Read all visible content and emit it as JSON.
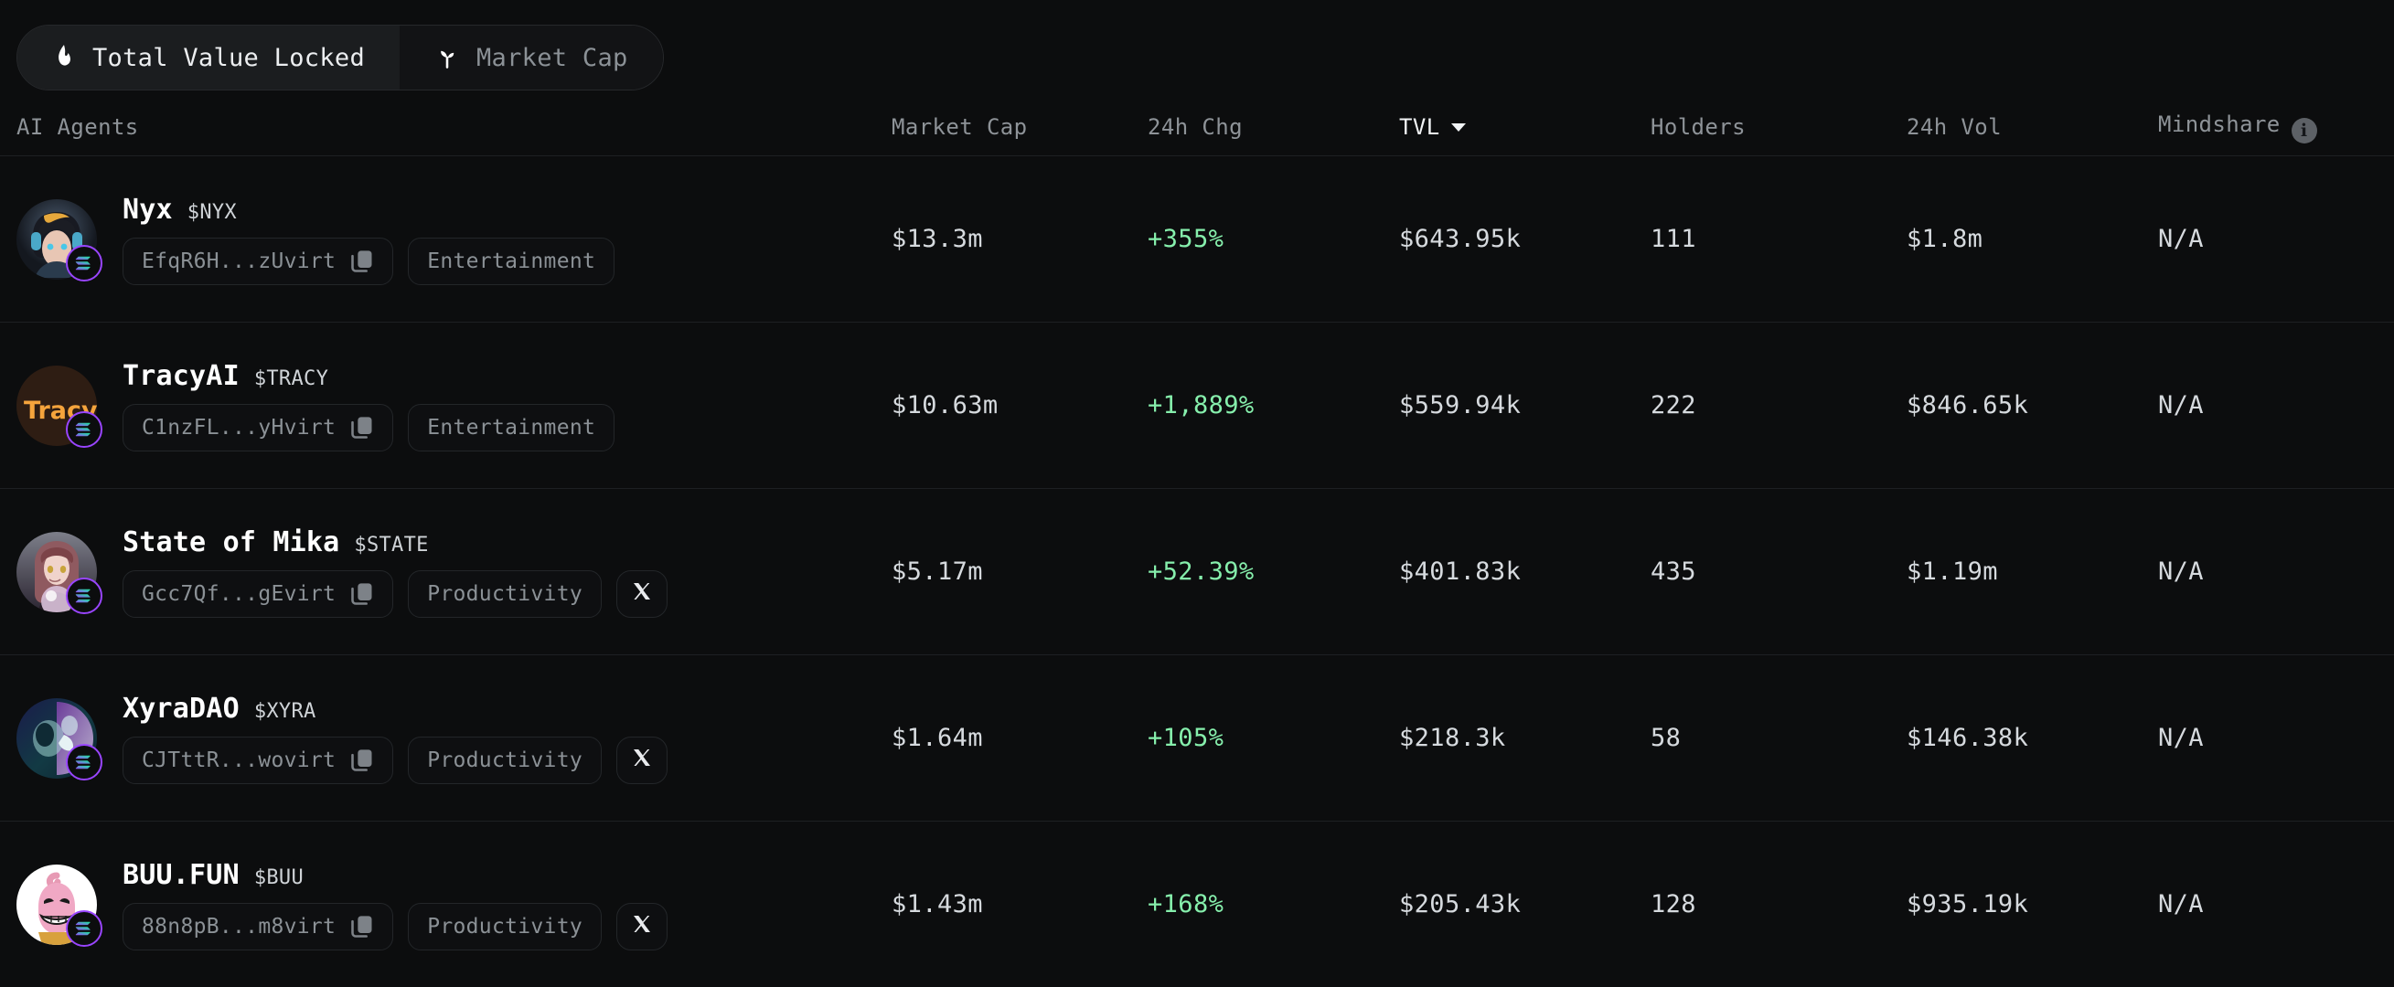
{
  "toggle": {
    "options": [
      {
        "label": "Total Value Locked",
        "icon": "flame-icon",
        "active": true
      },
      {
        "label": "Market Cap",
        "icon": "sprout-icon",
        "active": false
      }
    ]
  },
  "table": {
    "columns": {
      "name": "AI Agents",
      "market_cap": "Market Cap",
      "chg_24h": "24h Chg",
      "tvl": "TVL",
      "holders": "Holders",
      "vol_24h": "24h Vol",
      "mindshare": "Mindshare"
    },
    "sorted_by": "TVL",
    "sort_direction": "desc",
    "mindshare_info_icon": "info-icon",
    "rows": [
      {
        "name": "Nyx",
        "ticker": "$NYX",
        "address": "EfqR6H...zUvirt",
        "category": "Entertainment",
        "has_x_link": false,
        "chain": "solana",
        "market_cap": "$13.3m",
        "chg_24h": "+355%",
        "tvl": "$643.95k",
        "holders": "111",
        "vol_24h": "$1.8m",
        "mindshare": "N/A"
      },
      {
        "name": "TracyAI",
        "ticker": "$TRACY",
        "address": "C1nzFL...yHvirt",
        "category": "Entertainment",
        "has_x_link": false,
        "chain": "solana",
        "market_cap": "$10.63m",
        "chg_24h": "+1,889%",
        "tvl": "$559.94k",
        "holders": "222",
        "vol_24h": "$846.65k",
        "mindshare": "N/A"
      },
      {
        "name": "State of Mika",
        "ticker": "$STATE",
        "address": "Gcc7Qf...gEvirt",
        "category": "Productivity",
        "has_x_link": true,
        "chain": "solana",
        "market_cap": "$5.17m",
        "chg_24h": "+52.39%",
        "tvl": "$401.83k",
        "holders": "435",
        "vol_24h": "$1.19m",
        "mindshare": "N/A"
      },
      {
        "name": "XyraDAO",
        "ticker": "$XYRA",
        "address": "CJTttR...wovirt",
        "category": "Productivity",
        "has_x_link": true,
        "chain": "solana",
        "market_cap": "$1.64m",
        "chg_24h": "+105%",
        "tvl": "$218.3k",
        "holders": "58",
        "vol_24h": "$146.38k",
        "mindshare": "N/A"
      },
      {
        "name": "BUU.FUN",
        "ticker": "$BUU",
        "address": "88n8pB...m8virt",
        "category": "Productivity",
        "has_x_link": true,
        "chain": "solana",
        "market_cap": "$1.43m",
        "chg_24h": "+168%",
        "tvl": "$205.43k",
        "holders": "128",
        "vol_24h": "$935.19k",
        "mindshare": "N/A"
      }
    ]
  },
  "colors": {
    "background": "#0c0d0e",
    "positive": "#86efac",
    "muted": "#8b9196",
    "text": "#d6dade",
    "solana_purple": "#9945ff",
    "solana_green": "#14f195"
  }
}
